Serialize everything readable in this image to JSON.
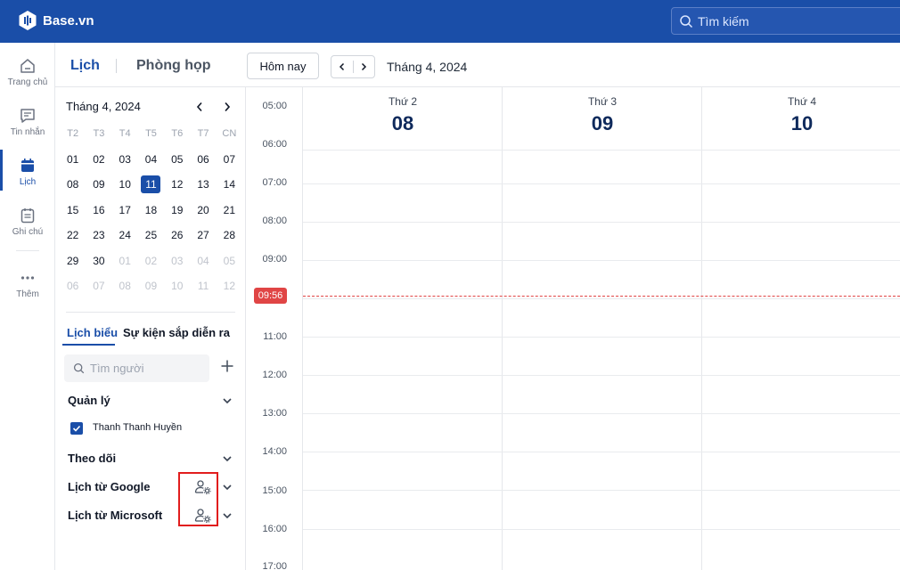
{
  "app": {
    "brand": "Base.vn",
    "search_placeholder": "Tìm kiếm"
  },
  "rail": [
    {
      "label": "Trang chủ",
      "icon": "home-icon"
    },
    {
      "label": "Tin nhắn",
      "icon": "message-icon"
    },
    {
      "label": "Lịch",
      "icon": "calendar-icon",
      "active": true
    },
    {
      "label": "Ghi chú",
      "icon": "notes-icon"
    },
    {
      "label": "Thêm",
      "icon": "more-icon"
    }
  ],
  "header": {
    "tab_calendar": "Lịch",
    "tab_rooms": "Phòng họp",
    "today_button": "Hôm nay",
    "period": "Tháng 4, 2024"
  },
  "mini_calendar": {
    "title": "Tháng 4, 2024",
    "weekdays": [
      "T2",
      "T3",
      "T4",
      "T5",
      "T6",
      "T7",
      "CN"
    ],
    "weeks": [
      [
        "01",
        "02",
        "03",
        "04",
        "05",
        "06",
        "07"
      ],
      [
        "08",
        "09",
        "10",
        "11",
        "12",
        "13",
        "14"
      ],
      [
        "15",
        "16",
        "17",
        "18",
        "19",
        "20",
        "21"
      ],
      [
        "22",
        "23",
        "24",
        "25",
        "26",
        "27",
        "28"
      ],
      [
        "29",
        "30",
        "01",
        "02",
        "03",
        "04",
        "05"
      ],
      [
        "06",
        "07",
        "08",
        "09",
        "10",
        "11",
        "12"
      ]
    ],
    "selected": "11"
  },
  "panel": {
    "tab_schedule": "Lịch biểu",
    "tab_upcoming": "Sự kiện sắp diễn ra",
    "people_search_placeholder": "Tìm người",
    "groups": {
      "manage": "Quản lý",
      "member": "Thanh Thanh Huyền",
      "follow": "Theo dõi",
      "google": "Lịch từ Google",
      "microsoft": "Lịch từ Microsoft"
    }
  },
  "week": {
    "days": [
      {
        "name": "Thứ 2",
        "date": "08"
      },
      {
        "name": "Thứ 3",
        "date": "09"
      },
      {
        "name": "Thứ 4",
        "date": "10"
      }
    ],
    "times": [
      "05:00",
      "06:00",
      "07:00",
      "08:00",
      "09:00",
      "11:00",
      "12:00",
      "13:00",
      "14:00",
      "15:00",
      "16:00",
      "17:00"
    ],
    "now": "09:56"
  },
  "colors": {
    "brand": "#1a4ea8",
    "now": "#e04545",
    "highlight": "#e11d1d"
  }
}
